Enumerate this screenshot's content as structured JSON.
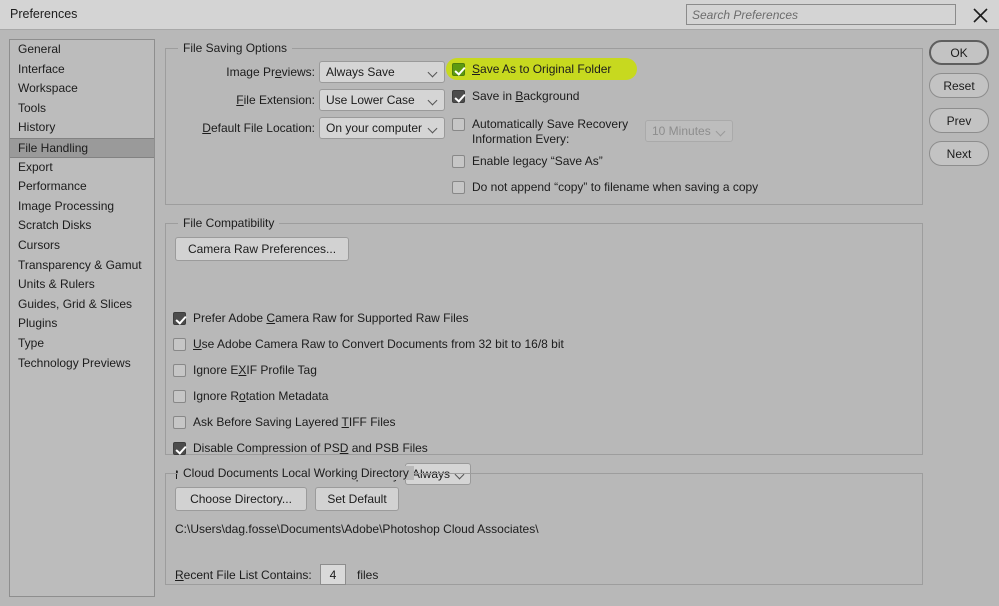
{
  "window": {
    "title": "Preferences",
    "close_icon": "close-icon"
  },
  "search": {
    "placeholder": "Search Preferences",
    "value": ""
  },
  "sidebar": {
    "selected": "File Handling",
    "items": [
      {
        "label": "General"
      },
      {
        "label": "Interface"
      },
      {
        "label": "Workspace"
      },
      {
        "label": "Tools"
      },
      {
        "label": "History"
      },
      {
        "label": "File Handling"
      },
      {
        "label": "Export"
      },
      {
        "label": "Performance"
      },
      {
        "label": "Image Processing"
      },
      {
        "label": "Scratch Disks"
      },
      {
        "label": "Cursors"
      },
      {
        "label": "Transparency & Gamut"
      },
      {
        "label": "Units & Rulers"
      },
      {
        "label": "Guides, Grid & Slices"
      },
      {
        "label": "Plugins"
      },
      {
        "label": "Type"
      },
      {
        "label": "Technology Previews"
      }
    ]
  },
  "dialog_buttons": [
    {
      "label": "OK",
      "primary": true
    },
    {
      "label": "Reset",
      "primary": false
    },
    {
      "label": "Prev",
      "primary": false
    },
    {
      "label": "Next",
      "primary": false
    }
  ],
  "file_saving": {
    "legend": "File Saving Options",
    "image_previews_label": "Image Previews:",
    "image_previews_value": "Always Save",
    "file_extension_label": "File Extension:",
    "file_extension_value": "Use Lower Case",
    "default_file_location_label": "Default File Location:",
    "default_file_location_value": "On your computer",
    "save_as_original_folder": "Save As to Original Folder",
    "save_in_background": "Save in Background",
    "auto_save_recovery_line1": "Automatically Save Recovery",
    "auto_save_recovery_line2": "Information Every:",
    "auto_save_interval_value": "10 Minutes",
    "enable_legacy_save_as": "Enable legacy “Save As”",
    "do_not_append_copy": "Do not append “copy” to filename when saving a copy"
  },
  "file_compatibility": {
    "legend": "File Compatibility",
    "camera_raw_button": "Camera Raw Preferences...",
    "prefer_acr": "Prefer Adobe Camera Raw for Supported Raw Files",
    "use_acr_convert": "Use Adobe Camera Raw to Convert Documents from 32 bit to 16/8 bit",
    "ignore_exif": "Ignore EXIF Profile Tag",
    "ignore_rotation": "Ignore Rotation Metadata",
    "ask_before_tiff": "Ask Before Saving Layered TIFF Files",
    "disable_compression": "Disable Compression of PSD and PSB Files",
    "maximize_label": "Maximize PSD and PSB File Compatibility:",
    "maximize_value": "Always"
  },
  "cloud": {
    "legend": "Cloud Documents Local Working Directory",
    "choose_directory_button": "Choose Directory...",
    "set_default_button": "Set Default",
    "path": "C:\\Users\\dag.fosse\\Documents\\Adobe\\Photoshop Cloud Associates\\"
  },
  "recent_files": {
    "label": "Recent File List Contains:",
    "value": "4",
    "suffix": "files"
  },
  "colors": {
    "dialog_bg": "#b8b8b8",
    "titlebar_bg": "#d4d4d4",
    "sidebar_bg": "#bcbcbc",
    "sidebar_selected": "#9a9a9a",
    "highlight": "#c7d91f",
    "checkbox_checked": "#4c4c4c",
    "control_bg": "#d5d5d5"
  }
}
